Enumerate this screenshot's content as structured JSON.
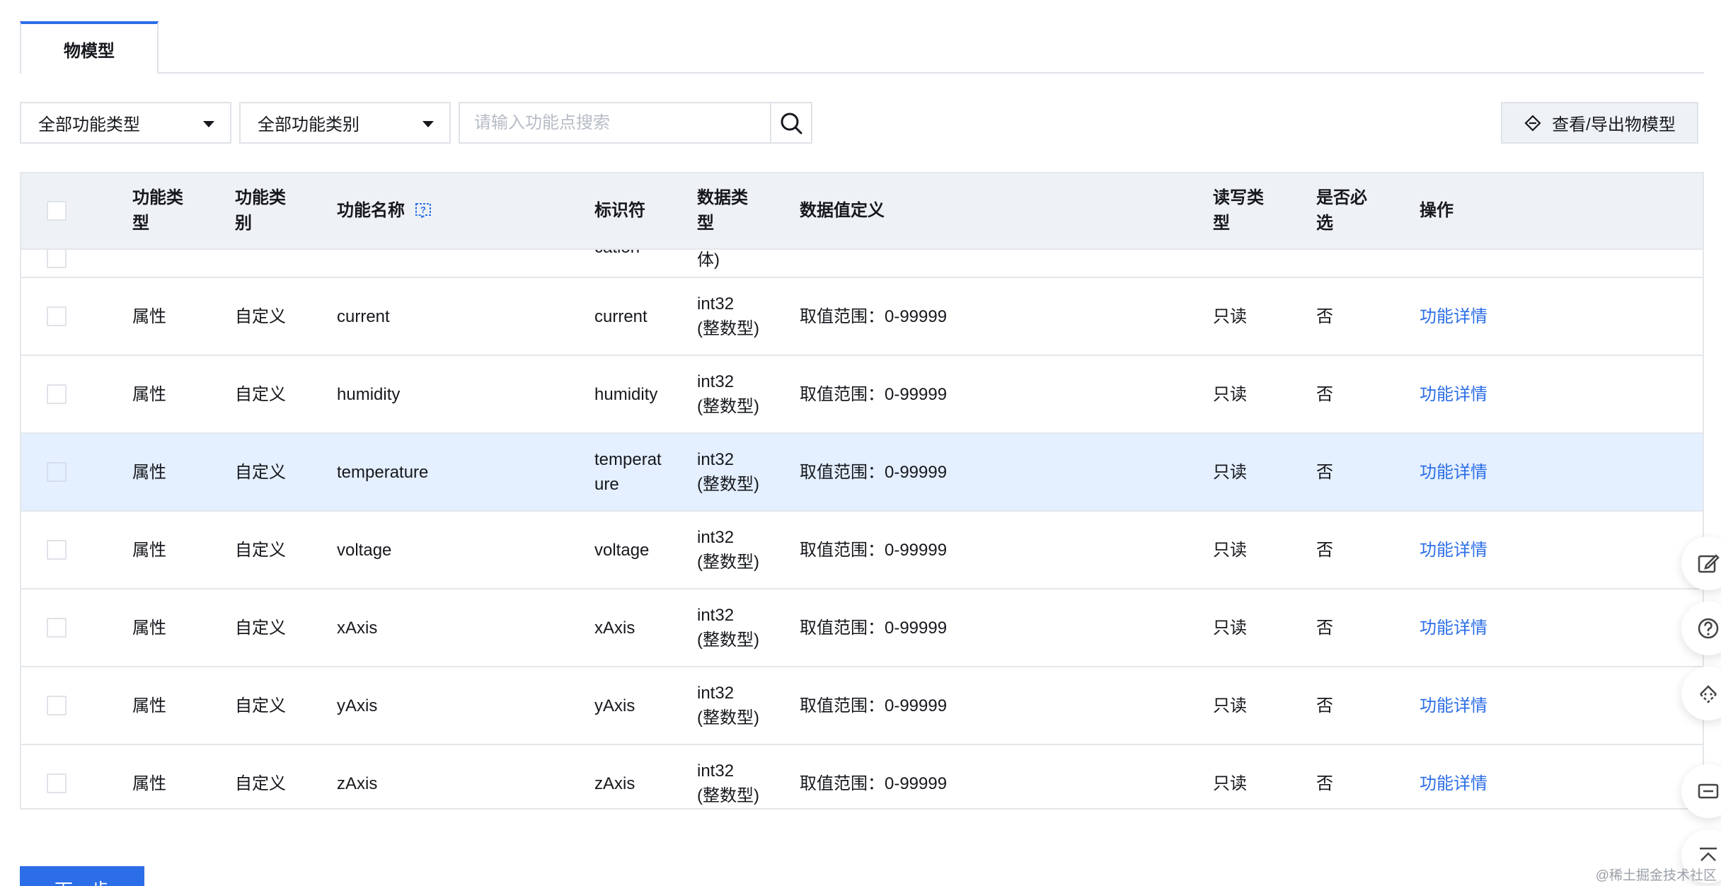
{
  "tabs": [
    {
      "label": "物模型"
    }
  ],
  "filters": {
    "func_type": "全部功能类型",
    "func_category": "全部功能类别",
    "search_placeholder": "请输入功能点搜索"
  },
  "export_button": {
    "label": "查看/导出物模型",
    "icon": "export-diamond-icon"
  },
  "table": {
    "headers": {
      "func_type": "功能类型",
      "func_category": "功能类别",
      "func_name": "功能名称",
      "identifier": "标识符",
      "data_type": "数据类型",
      "data_def": "数据值定义",
      "rw": "读写类型",
      "required": "是否必选",
      "op": "操作"
    },
    "partial_row": {
      "identifier_tail": "cation",
      "data_type_tail": "体)"
    },
    "rows": [
      {
        "type": "属性",
        "category": "自定义",
        "name": "current",
        "identifier": "current",
        "data_type": "int32 (整数型)",
        "def": "取值范围：0-99999",
        "rw": "只读",
        "required": "否",
        "op": "功能详情"
      },
      {
        "type": "属性",
        "category": "自定义",
        "name": "humidity",
        "identifier": "humidity",
        "data_type": "int32 (整数型)",
        "def": "取值范围：0-99999",
        "rw": "只读",
        "required": "否",
        "op": "功能详情"
      },
      {
        "type": "属性",
        "category": "自定义",
        "name": "temperature",
        "identifier": "temperature",
        "data_type": "int32 (整数型)",
        "def": "取值范围：0-99999",
        "rw": "只读",
        "required": "否",
        "op": "功能详情"
      },
      {
        "type": "属性",
        "category": "自定义",
        "name": "voltage",
        "identifier": "voltage",
        "data_type": "int32 (整数型)",
        "def": "取值范围：0-99999",
        "rw": "只读",
        "required": "否",
        "op": "功能详情"
      },
      {
        "type": "属性",
        "category": "自定义",
        "name": "xAxis",
        "identifier": "xAxis",
        "data_type": "int32 (整数型)",
        "def": "取值范围：0-99999",
        "rw": "只读",
        "required": "否",
        "op": "功能详情"
      },
      {
        "type": "属性",
        "category": "自定义",
        "name": "yAxis",
        "identifier": "yAxis",
        "data_type": "int32 (整数型)",
        "def": "取值范围：0-99999",
        "rw": "只读",
        "required": "否",
        "op": "功能详情"
      },
      {
        "type": "属性",
        "category": "自定义",
        "name": "zAxis",
        "identifier": "zAxis",
        "data_type": "int32 (整数型)",
        "def": "取值范围：0-99999",
        "rw": "只读",
        "required": "否",
        "op": "功能详情"
      }
    ]
  },
  "next_button": {
    "label": "下一步"
  },
  "floating_tools": [
    "edit-icon",
    "help-icon",
    "service-icon",
    "minimize-icon",
    "back-to-top-icon"
  ],
  "watermark": "@稀土掘金技术社区",
  "colors": {
    "accent": "#2c6ee8",
    "header_bg": "#eef2f6",
    "highlight_row": "#e4efff",
    "border": "#dfe3e8"
  }
}
